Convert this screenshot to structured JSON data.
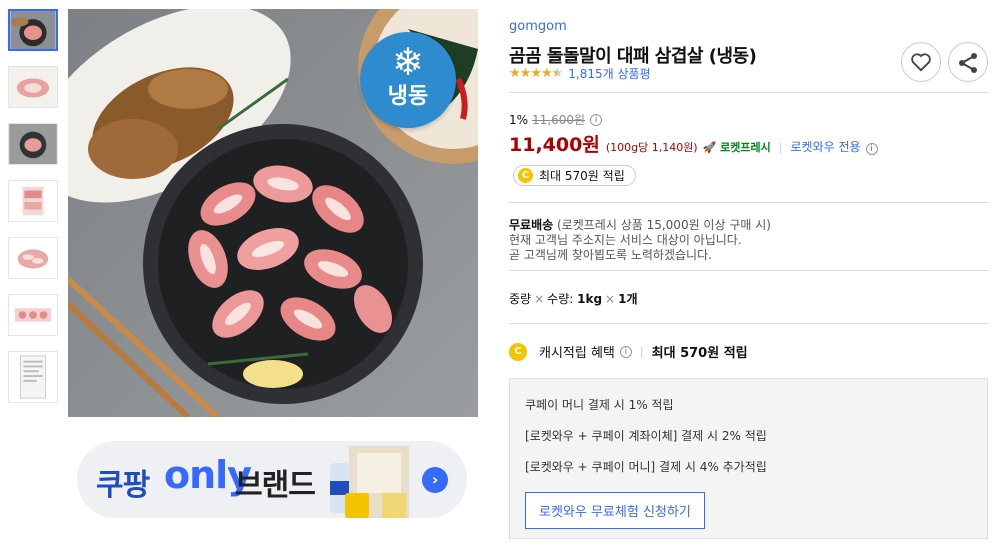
{
  "thumbnails": [
    {
      "name": "thumbnail-1",
      "active": true
    },
    {
      "name": "thumbnail-2",
      "active": false
    },
    {
      "name": "thumbnail-3",
      "active": false
    },
    {
      "name": "thumbnail-4",
      "active": false
    },
    {
      "name": "thumbnail-5",
      "active": false
    },
    {
      "name": "thumbnail-6",
      "active": false
    },
    {
      "name": "thumbnail-7",
      "active": false
    }
  ],
  "main_image": {
    "frozen_badge": "냉동",
    "frozen_icon": "snowflake-icon"
  },
  "banner": {
    "part1": "쿠팡",
    "part2": "only",
    "part3": "브랜드",
    "arrow": "›"
  },
  "product": {
    "brand": "gomgom",
    "title": "곰곰 돌돌말이 대패 삼겹살 (냉동)",
    "stars": "★★★★★",
    "rating": 4.5,
    "review_count": "1,815개 상품평",
    "discount": "1%",
    "original_price": "11,600원",
    "price": "11,400원",
    "unit_price": "(100g당 1,140원)",
    "rocket_label": "로켓프레시",
    "rocket_icon": "rocket-icon",
    "wow_only": "로켓와우 전용",
    "points_pill": "최대 570원 적립"
  },
  "shipping": {
    "label": "무료배송",
    "condition": "(로켓프레시 상품 15,000원 이상 구매 시)",
    "notice1": "현재 고객님 주소지는 서비스 대상이 아닙니다.",
    "notice2": "곧 고객님께 찾아뵙도록 노력하겠습니다."
  },
  "option": {
    "label1": "중량",
    "label2": "수량",
    "value1": "1kg",
    "value2": "1개"
  },
  "cash": {
    "label": "캐시적립 혜택",
    "max": "최대 570원 적립"
  },
  "benefits": {
    "lines": [
      "쿠페이 머니 결제 시 1% 적립",
      "[로켓와우 + 쿠페이 계좌이체] 결제 시 2% 적립",
      "[로켓와우 + 쿠페이 머니] 결제 시 4% 추가적립"
    ],
    "trial_button": "로켓와우 무료체험 신청하기"
  },
  "icons": {
    "heart": "heart-icon",
    "share": "share-icon",
    "info": "info-icon",
    "coin": "coin-icon"
  },
  "colors": {
    "accent": "#346aff",
    "price": "#ae0000",
    "rocket": "#00891a",
    "star": "#f5a623",
    "coin": "#f5c400"
  }
}
